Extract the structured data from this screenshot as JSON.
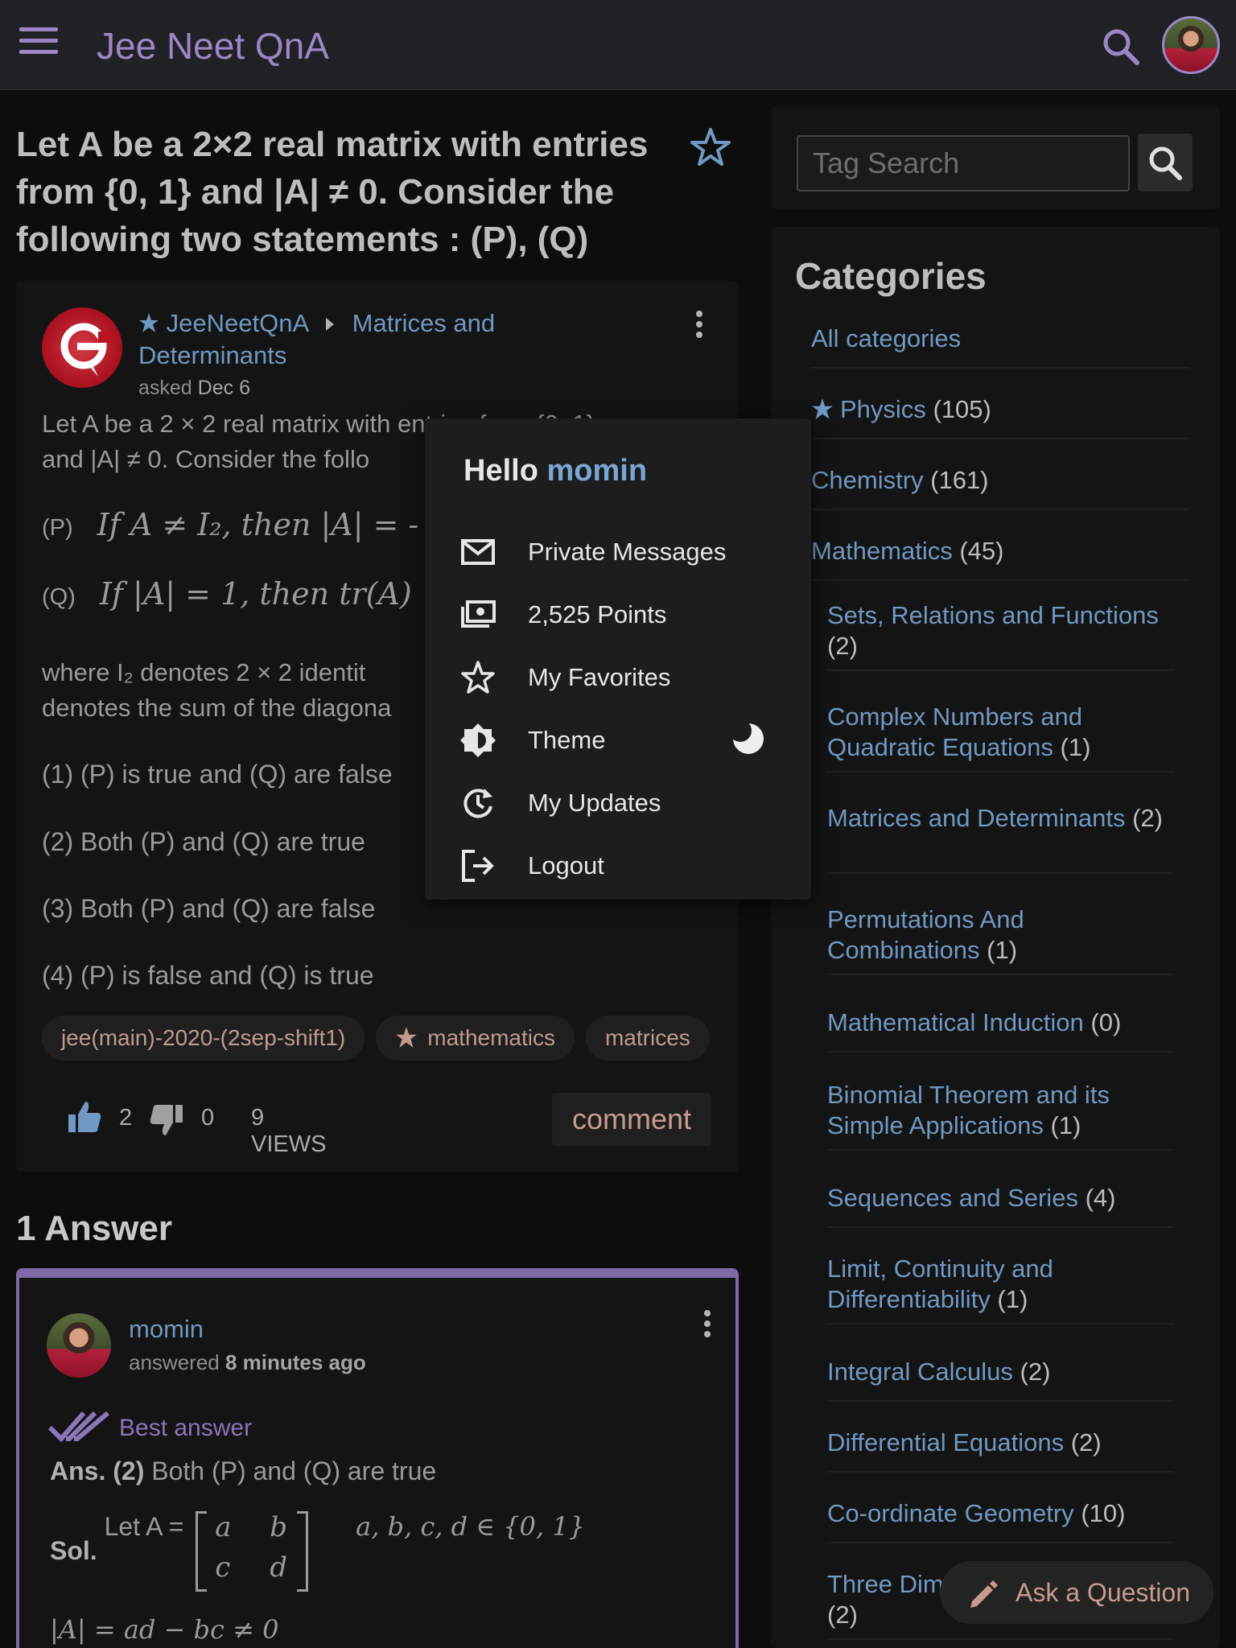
{
  "header": {
    "site_title": "Jee Neet QnA"
  },
  "question": {
    "title": "Let A be a 2×2 real matrix with entries from {0, 1} and |A| ≠ 0. Consider the following two statements : (P), (Q)",
    "author": "JeeNeetQnA",
    "category": "Matrices and Determinants",
    "asked_label": "asked",
    "asked_date": "Dec 6",
    "body_line1": "Let A be a 2 × 2 real matrix wi",
    "body_line1_tail": "th entries from {0, 1}",
    "body_line2": "and |A| ≠ 0. Consider the follo",
    "stmt_p_label": "(P)",
    "stmt_p_math": "If A ≠ I₂, then |A| = -",
    "stmt_q_label": "(Q)",
    "stmt_q_math": "If |A| = 1, then tr(A)",
    "body_line3": "where I₂ denotes 2 × 2 identit",
    "body_line4": "denotes the sum of the diagona",
    "options": [
      "(1) (P) is true and (Q) are false",
      "(2) Both (P) and (Q) are true",
      "(3) Both (P) and (Q) are false",
      "(4) (P) is false and (Q) is true"
    ],
    "tags": [
      "jee(main)-2020-(2sep-shift1)",
      "mathematics",
      "matrices"
    ],
    "upvotes": "2",
    "downvotes": "0",
    "views": "9 VIEWS",
    "comment_label": "comment"
  },
  "answers": {
    "heading": "1 Answer",
    "user": "momin",
    "answered_label": "answered",
    "answered_time": "8 minutes ago",
    "best_label": "Best answer",
    "ans_prefix": "Ans. (2)",
    "ans_text": "Both (P) and (Q) are true",
    "sol_prefix": "Sol.",
    "sol_text": "Let A =",
    "matrix": [
      "a",
      "b",
      "c",
      "d"
    ],
    "sol_cond": "a, b, c, d ∈ {0, 1}",
    "det_line": "|A| = ad − bc ≠ 0"
  },
  "sidebar": {
    "tag_search_placeholder": "Tag Search",
    "categories_title": "Categories",
    "categories": [
      {
        "name": "All categories",
        "count": ""
      },
      {
        "name": "Physics",
        "count": "(105)"
      },
      {
        "name": "Chemistry",
        "count": "(161)"
      },
      {
        "name": "Mathematics",
        "count": "(45)"
      },
      {
        "name": "Sets, Relations and Functions",
        "count": "(2)"
      },
      {
        "name": "Complex Numbers and Quadratic Equations",
        "count": "(1)"
      },
      {
        "name": "Matrices and Determinants",
        "count": "(2)"
      },
      {
        "name": "Permutations And Combinations",
        "count": "(1)"
      },
      {
        "name": "Mathematical Induction",
        "count": "(0)"
      },
      {
        "name": "Binomial Theorem and its Simple Applications",
        "count": "(1)"
      },
      {
        "name": "Sequences and Series",
        "count": "(4)"
      },
      {
        "name": "Limit, Continuity and Differentiability",
        "count": "(1)"
      },
      {
        "name": "Integral Calculus",
        "count": "(2)"
      },
      {
        "name": "Differential Equations",
        "count": "(2)"
      },
      {
        "name": "Co-ordinate Geometry",
        "count": "(10)"
      },
      {
        "name": "Three Dim",
        "count": "(2)"
      }
    ]
  },
  "user_menu": {
    "hello": "Hello",
    "username": "momin",
    "items": [
      "Private Messages",
      "2,525 Points",
      "My Favorites",
      "Theme",
      "My Updates",
      "Logout"
    ]
  },
  "ask_button": "Ask a Question",
  "colors": {
    "accent_purple": "#9b86c6",
    "link_blue": "#6f98c2",
    "tag_text": "#c19a8f",
    "background": "#0d0d0d"
  }
}
